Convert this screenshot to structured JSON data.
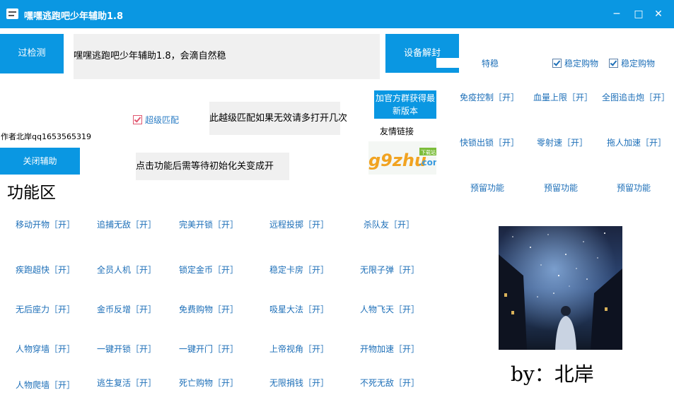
{
  "window": {
    "title": "嘿嘿逃跑吧少年辅助1.8",
    "controls": [
      "✕",
      "□",
      "─"
    ]
  },
  "top": {
    "detect_button": "过检测",
    "banner_text": "嘿嘿逃跑吧少年辅助1.8，会滴自然稳",
    "device_unseal_button": "设备解封",
    "stable_label": "特稳",
    "stable_buy_1": "稳定购物",
    "stable_buy_2": "稳定购物"
  },
  "middle": {
    "join_group_button_line1": "加官方群获得最",
    "join_group_button_line2": "新版本",
    "super_match": "超级匹配",
    "super_match_hint": "此越级匹配如果无效请多打开几次",
    "author": "作者北岸qq1653565319",
    "friend_links": "友情链接",
    "logo_text": "g9zhu",
    "logo_suffix": ".com",
    "logo_badge": "下载站",
    "close_button": "关闭辅助",
    "wait_hint": "点击功能后需等待初始化关变成开"
  },
  "right_features": [
    "免疫控制［开］",
    "血量上限［开］",
    "全图追击炮［开］",
    "快锁出锁［开］",
    "零射速［开］",
    "拖人加速［开］",
    "预留功能",
    "预留功能",
    "预留功能"
  ],
  "section_title": "功能区",
  "features": [
    "移动开物［开］",
    "追捕无敌［开］",
    "完美开锁［开］",
    "远程投掷［开］",
    "杀队友［开］",
    "疾跑超快［开］",
    "全员人机［开］",
    "锁定金币［开］",
    "稳定卡房［开］",
    "无限子弹［开］",
    "无后座力［开］",
    "金币反增［开］",
    "免费购物［开］",
    "吸星大法［开］",
    "人物飞天［开］",
    "人物穿墙［开］",
    "一键开锁［开］",
    "一键开门［开］",
    "上帝视角［开］",
    "开物加速［开］",
    "人物爬墙［开］",
    "逃生复活［开］",
    "死亡购物［开］",
    "无限捐钱［开］",
    "不死无敌［开］"
  ],
  "signature": "by：北岸",
  "colors": {
    "accent": "#0a97e2",
    "link": "#1d6fb8",
    "panel": "#f0f0f0"
  }
}
